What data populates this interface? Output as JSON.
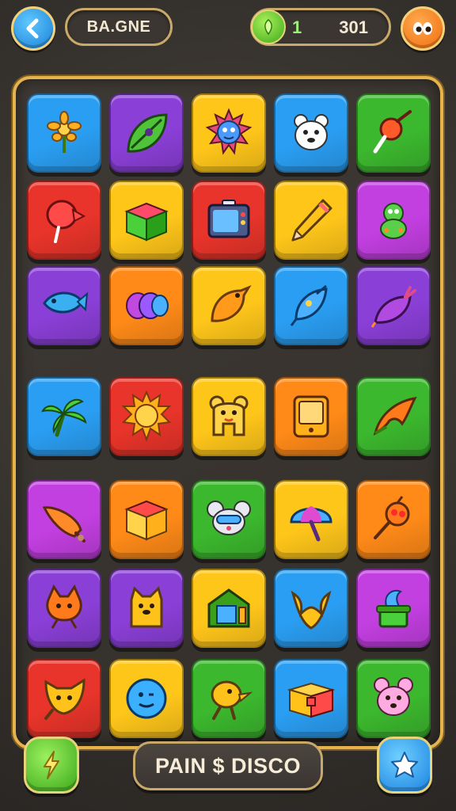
{
  "header": {
    "title": "BA.GNE",
    "level": "1",
    "score": "301"
  },
  "footer": {
    "action_label": "PAIN $ DISCO"
  },
  "colors": {
    "blue": "#2a9ef2",
    "purple": "#8a3fd6",
    "yellow": "#ffc61a",
    "red": "#e8342a",
    "green": "#3cb82e",
    "orange": "#ff8a18",
    "magenta": "#c23fe0",
    "board_border": "#e5b24c"
  },
  "tiles": [
    {
      "color": "blue",
      "icon": "flower-icon"
    },
    {
      "color": "purple",
      "icon": "leaf-icon"
    },
    {
      "color": "yellow",
      "icon": "sun-fish-icon"
    },
    {
      "color": "blue",
      "icon": "bear-icon"
    },
    {
      "color": "green",
      "icon": "lollipop-icon"
    },
    {
      "color": "red",
      "icon": "balloon-icon"
    },
    {
      "color": "yellow",
      "icon": "box-icon"
    },
    {
      "color": "red",
      "icon": "tv-icon"
    },
    {
      "color": "yellow",
      "icon": "pencil-icon"
    },
    {
      "color": "magenta",
      "icon": "robot-icon"
    },
    {
      "color": "purple",
      "icon": "fish-icon"
    },
    {
      "color": "orange",
      "icon": "bubbles-icon"
    },
    {
      "color": "yellow",
      "icon": "bird-icon"
    },
    {
      "color": "blue",
      "icon": "drop-icon"
    },
    {
      "color": "purple",
      "icon": "radish-icon"
    },
    {
      "color": "blue",
      "icon": "palm-icon"
    },
    {
      "color": "red",
      "icon": "sun-icon"
    },
    {
      "color": "yellow",
      "icon": "bear-face-icon"
    },
    {
      "color": "orange",
      "icon": "phone-icon"
    },
    {
      "color": "green",
      "icon": "flame-leaf-icon"
    },
    {
      "color": "magenta",
      "icon": "carrot-icon"
    },
    {
      "color": "orange",
      "icon": "gift-box-icon"
    },
    {
      "color": "green",
      "icon": "mouse-icon"
    },
    {
      "color": "yellow",
      "icon": "umbrella-icon"
    },
    {
      "color": "orange",
      "icon": "ladybug-icon"
    },
    {
      "color": "purple",
      "icon": "cat-icon"
    },
    {
      "color": "purple",
      "icon": "dog-icon"
    },
    {
      "color": "yellow",
      "icon": "house-icon"
    },
    {
      "color": "blue",
      "icon": "shell-icon"
    },
    {
      "color": "magenta",
      "icon": "plant-pot-icon"
    },
    {
      "color": "red",
      "icon": "fox-icon"
    },
    {
      "color": "yellow",
      "icon": "smile-ball-icon"
    },
    {
      "color": "green",
      "icon": "duck-icon"
    },
    {
      "color": "blue",
      "icon": "treasure-box-icon"
    },
    {
      "color": "green",
      "icon": "pink-bear-icon"
    }
  ]
}
